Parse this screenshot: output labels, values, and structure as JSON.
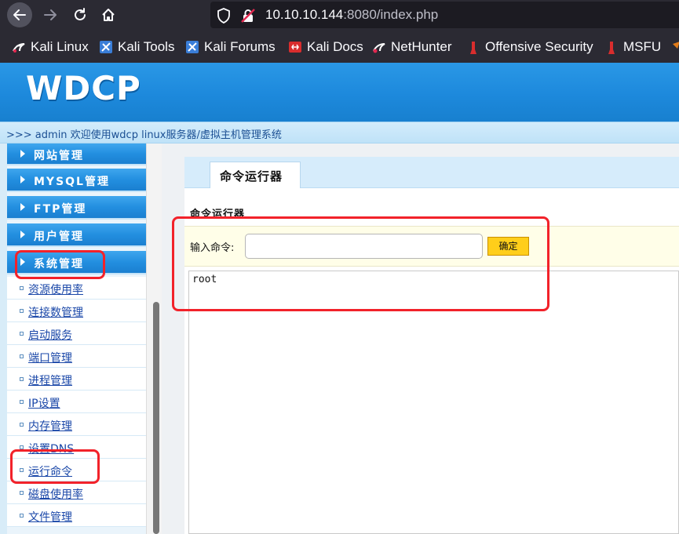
{
  "browser": {
    "url_host": "10.10.10.144",
    "url_rest": ":8080/index.php",
    "bookmarks": [
      {
        "label": "Kali Linux",
        "icon": "kali-dragon-icon"
      },
      {
        "label": "Kali Tools",
        "icon": "kali-tools-icon"
      },
      {
        "label": "Kali Forums",
        "icon": "kali-forums-icon"
      },
      {
        "label": "Kali Docs",
        "icon": "kali-docs-icon"
      },
      {
        "label": "NetHunter",
        "icon": "nethunter-icon"
      },
      {
        "label": "Offensive Security",
        "icon": "offsec-icon"
      },
      {
        "label": "MSFU",
        "icon": "msfu-icon"
      }
    ]
  },
  "header": {
    "logo": "WDCP",
    "welcome": ">>> admin 欢迎使用wdcp linux服务器/虚拟主机管理系统"
  },
  "sidebar": {
    "menus": [
      {
        "label": "网站管理"
      },
      {
        "label": "MYSQL管理"
      },
      {
        "label": "FTP管理"
      },
      {
        "label": "用户管理"
      },
      {
        "label": "系统管理"
      }
    ],
    "sub_items": [
      {
        "label": "资源使用率"
      },
      {
        "label": "连接数管理"
      },
      {
        "label": "启动服务"
      },
      {
        "label": "端口管理"
      },
      {
        "label": "进程管理"
      },
      {
        "label": "IP设置"
      },
      {
        "label": "内存管理"
      },
      {
        "label": "设置DNS"
      },
      {
        "label": "运行命令"
      },
      {
        "label": "磁盘使用率"
      },
      {
        "label": "文件管理"
      }
    ]
  },
  "main": {
    "tab_label": "命令运行器",
    "panel_title": "命令运行器",
    "input_label": "输入命令:",
    "input_value": "",
    "submit_label": "确定",
    "output": "root"
  },
  "colors": {
    "accent_blue": "#1d89dc",
    "annotation_red": "#f2222a",
    "submit_yellow": "#ffce1a"
  }
}
